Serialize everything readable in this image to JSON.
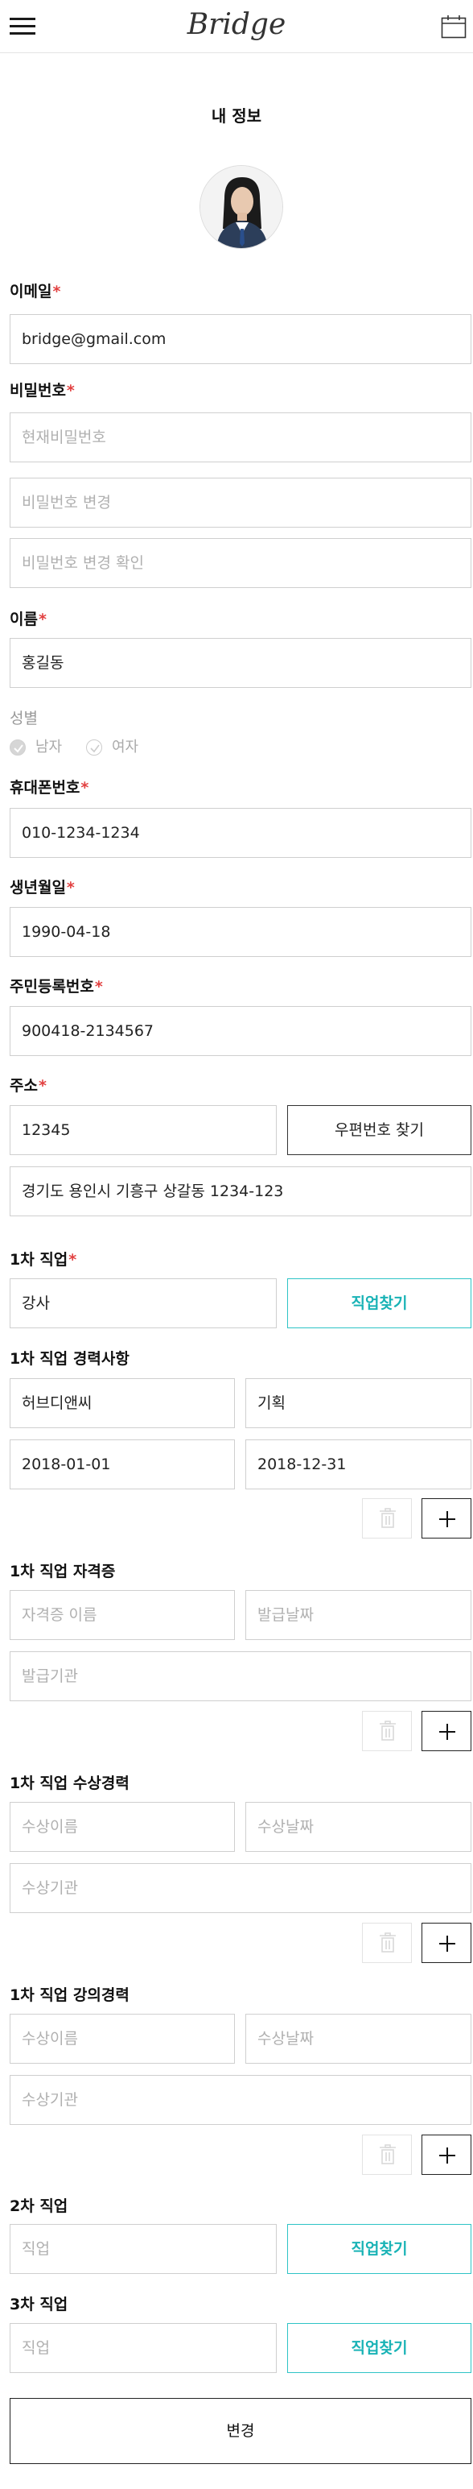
{
  "header": {
    "logo": "Bridge",
    "menu_icon": "hamburger-menu-icon",
    "calendar_icon": "calendar-icon"
  },
  "page_title": "내 정보",
  "profile": {
    "avatar": "profile-avatar"
  },
  "required_mark": "*",
  "email": {
    "label": "이메일",
    "value": "bridge@gmail.com"
  },
  "password": {
    "label": "비밀번호",
    "current_placeholder": "현재비밀번호",
    "new_placeholder": "비밀번호 변경",
    "confirm_placeholder": "비밀번호 변경 확인"
  },
  "name": {
    "label": "이름",
    "value": "홍길동"
  },
  "gender": {
    "label": "성별",
    "options": [
      "남자",
      "여자"
    ],
    "selected": "남자"
  },
  "phone": {
    "label": "휴대폰번호",
    "value": "010-1234-1234"
  },
  "birth": {
    "label": "생년월일",
    "value": "1990-04-18"
  },
  "resident_id": {
    "label": "주민등록번호",
    "value": "900418-2134567"
  },
  "address": {
    "label": "주소",
    "postcode": "12345",
    "find_button": "우편번호 찾기",
    "detail": "경기도 용인시 기흥구 상갈동 1234-123"
  },
  "job1": {
    "label": "1차 직업",
    "value": "강사",
    "find_button": "직업찾기"
  },
  "job1_career": {
    "label": "1차 직업 경력사항",
    "company": "허브디앤씨",
    "role": "기획",
    "start": "2018-01-01",
    "end": "2018-12-31"
  },
  "job1_license": {
    "label": "1차 직업 자격증",
    "name_placeholder": "자격증 이름",
    "date_placeholder": "발급날짜",
    "issuer_placeholder": "발급기관"
  },
  "job1_award": {
    "label": "1차 직업 수상경력",
    "name_placeholder": "수상이름",
    "date_placeholder": "수상날짜",
    "org_placeholder": "수상기관"
  },
  "job1_lecture": {
    "label": "1차 직업 강의경력",
    "name_placeholder": "수상이름",
    "date_placeholder": "수상날짜",
    "org_placeholder": "수상기관"
  },
  "job2": {
    "label": "2차 직업",
    "placeholder": "직업",
    "find_button": "직업찾기"
  },
  "job3": {
    "label": "3차 직업",
    "placeholder": "직업",
    "find_button": "직업찾기"
  },
  "row_actions": {
    "delete_icon": "trash-icon",
    "add_icon": "plus-icon"
  },
  "submit": "변경"
}
